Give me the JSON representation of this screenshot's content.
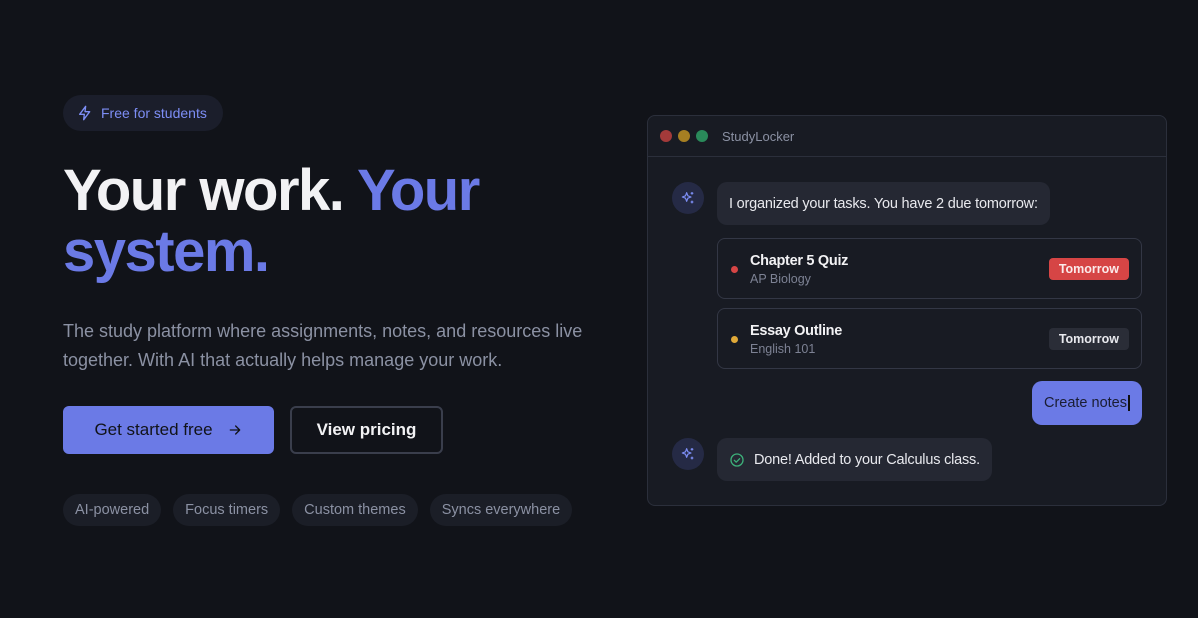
{
  "hero": {
    "badge": "Free for students",
    "headline_white": "Your work.",
    "headline_accent_1": "Your",
    "headline_accent_2": "system.",
    "subtitle": "The study platform where assignments, notes, and resources live together. With AI that actually helps manage your work.",
    "primary_button": "Get started free",
    "secondary_button": "View pricing",
    "tags": [
      "AI-powered",
      "Focus timers",
      "Custom themes",
      "Syncs everywhere"
    ]
  },
  "window": {
    "title": "StudyLocker",
    "ai_message_1": "I organized your tasks. You have 2 due tomorrow:",
    "tasks": [
      {
        "title": "Chapter 5 Quiz",
        "course": "AP Biology",
        "due": "Tomorrow",
        "color": "#d64545",
        "urgent": true
      },
      {
        "title": "Essay Outline",
        "course": "English 101",
        "due": "Tomorrow",
        "color": "#e0a938",
        "urgent": false
      }
    ],
    "user_message": "Create notes",
    "ai_message_2": "Done! Added to your Calculus class."
  },
  "colors": {
    "accent": "#6b7ae6",
    "background": "#111319",
    "urgent": "#d64545",
    "success": "#3db07a"
  },
  "icons": {
    "badge": "lightning-icon",
    "primary_button": "arrow-right-icon",
    "ai_avatar": "sparkles-icon",
    "confirmation": "check-circle-icon"
  }
}
